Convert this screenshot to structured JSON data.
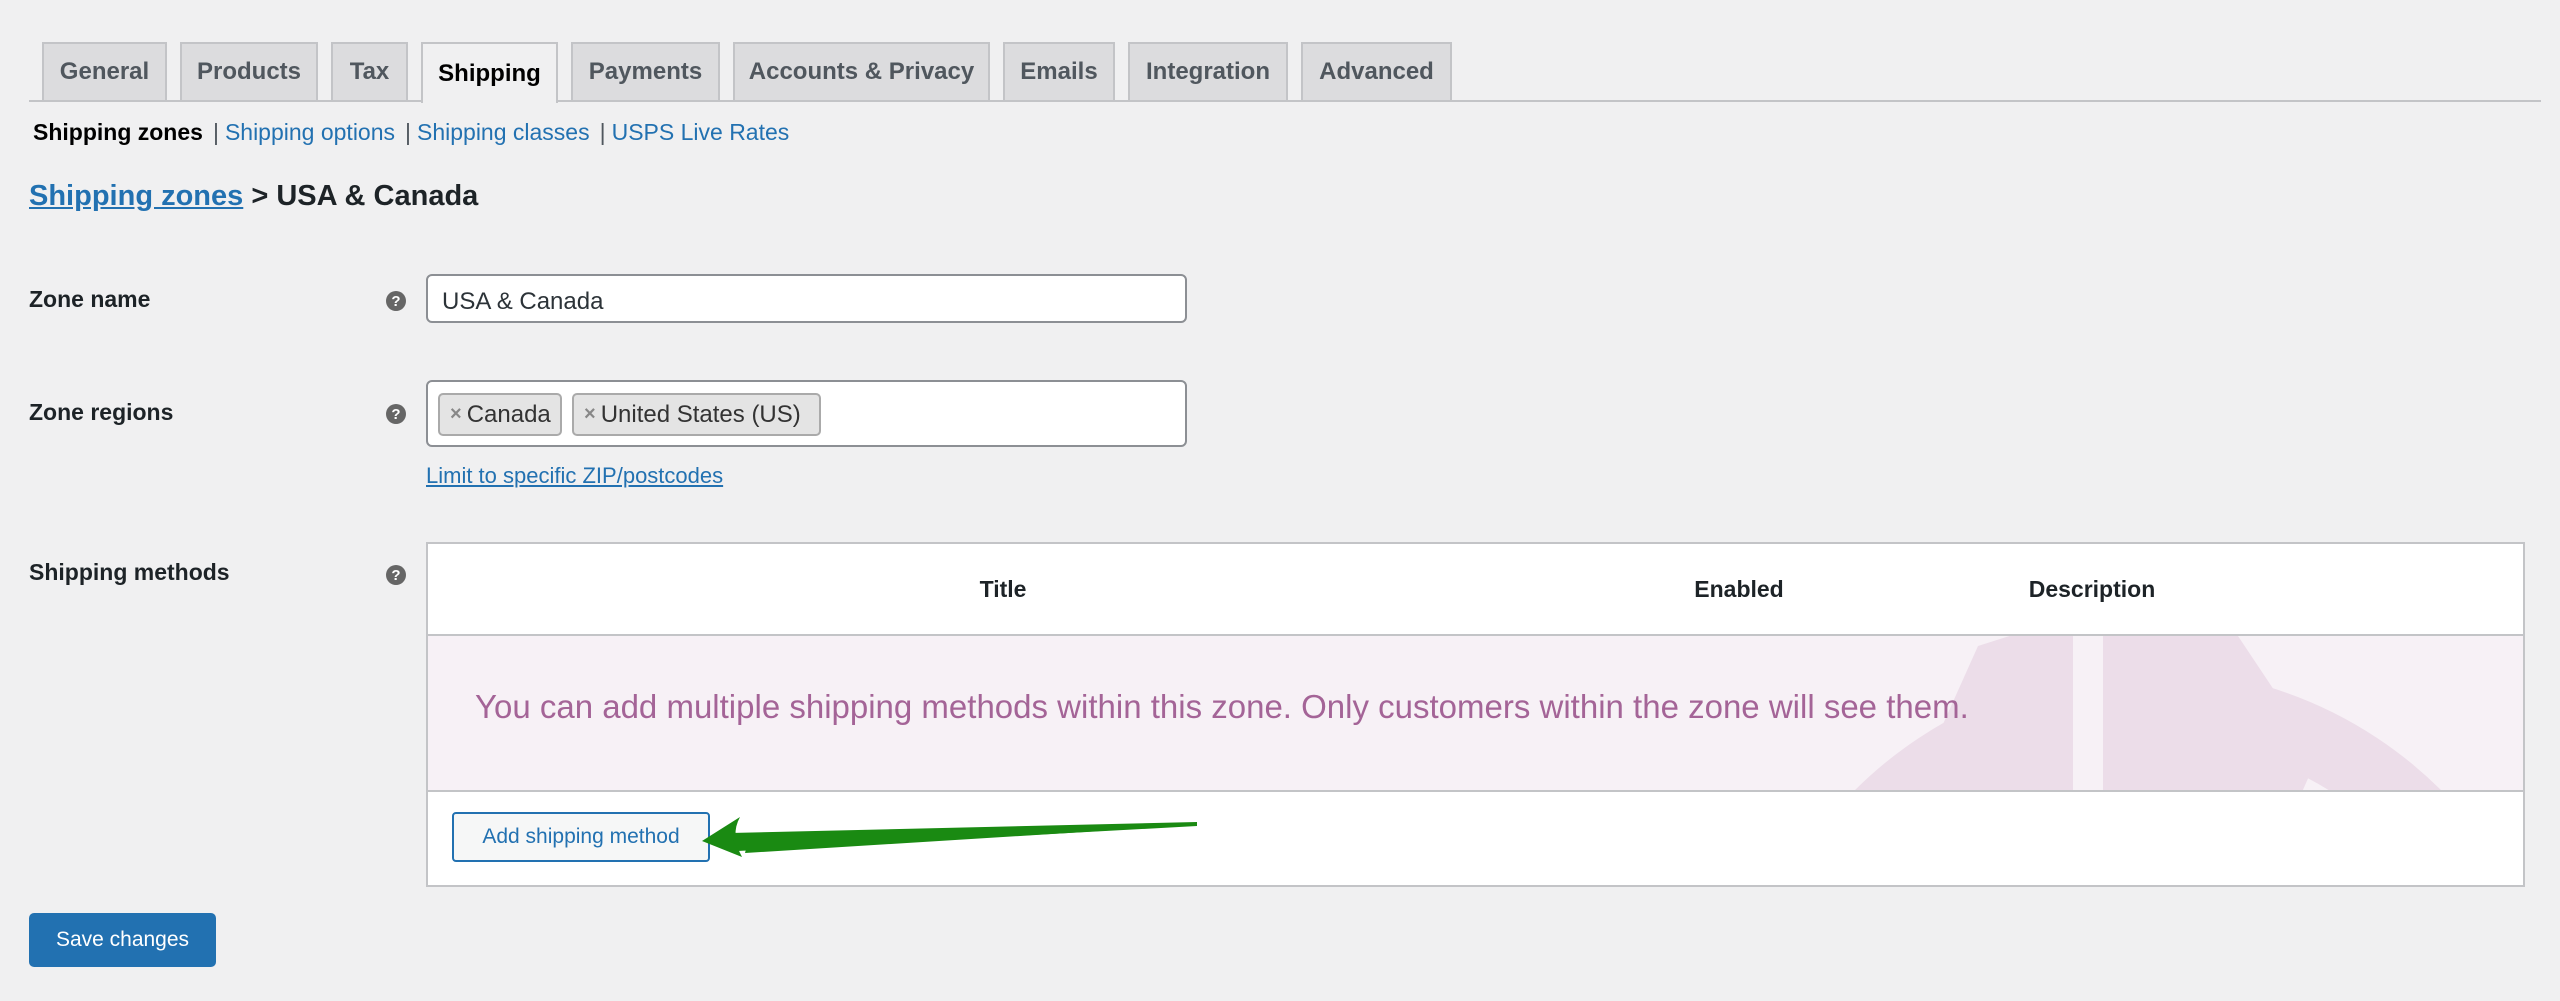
{
  "tabs": [
    {
      "label": "General"
    },
    {
      "label": "Products"
    },
    {
      "label": "Tax"
    },
    {
      "label": "Shipping",
      "active": true
    },
    {
      "label": "Payments"
    },
    {
      "label": "Accounts & Privacy"
    },
    {
      "label": "Emails"
    },
    {
      "label": "Integration"
    },
    {
      "label": "Advanced"
    }
  ],
  "subnav": {
    "current": "Shipping zones",
    "items": [
      "Shipping options",
      "Shipping classes",
      "USPS Live Rates"
    ],
    "separator": "|"
  },
  "heading": {
    "link": "Shipping zones",
    "rest": "> USA & Canada"
  },
  "form": {
    "zone_name_label": "Zone name",
    "zone_name_value": "USA & Canada",
    "zone_regions_label": "Zone regions",
    "regions": [
      "Canada",
      "United States (US)"
    ],
    "remove_glyph": "×",
    "limit_link": "Limit to specific ZIP/postcodes",
    "shipping_methods_label": "Shipping methods",
    "help_glyph": "?"
  },
  "methods_table": {
    "columns": [
      "Title",
      "Enabled",
      "Description"
    ],
    "blank_state": "You can add multiple shipping methods within this zone. Only customers within the zone will see them.",
    "add_button": "Add shipping method"
  },
  "save_button": "Save changes",
  "colors": {
    "accent": "#2271b1",
    "blank_state_text": "#a46497",
    "blank_state_bg": "#f7f1f6",
    "annotation_arrow": "#1a8a12"
  }
}
